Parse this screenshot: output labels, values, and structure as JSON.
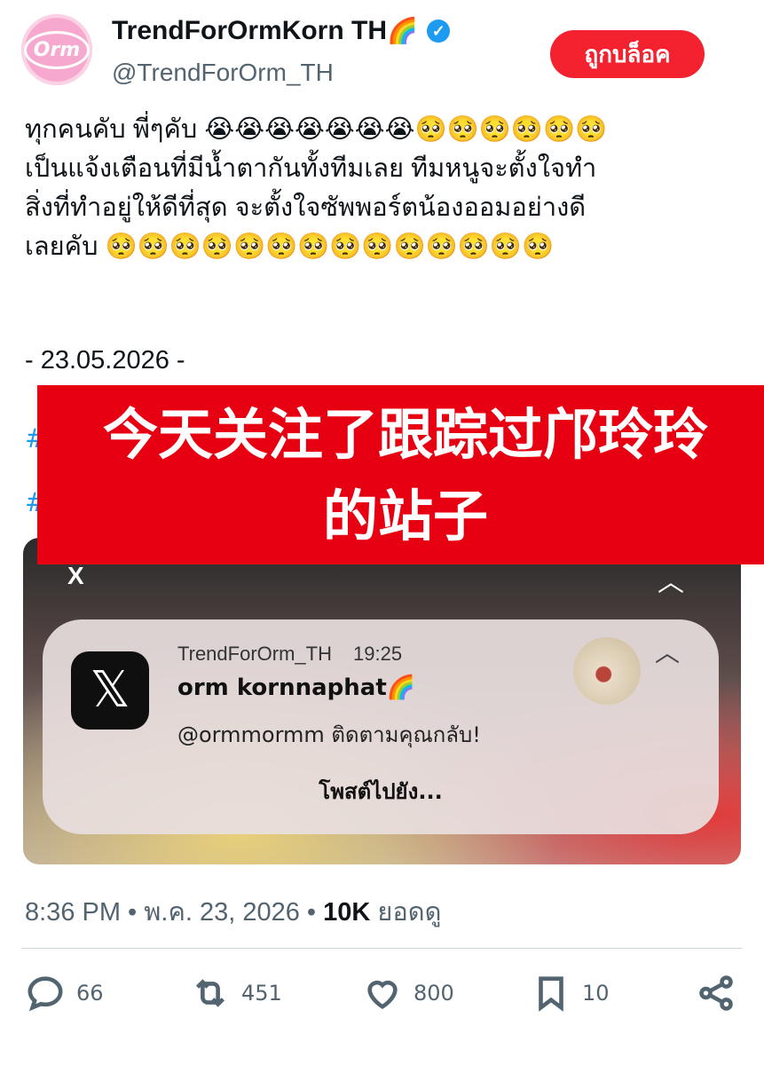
{
  "profile": {
    "avatar_text": "Orm",
    "display_name": "TrendForOrmKorn TH",
    "display_name_emoji": "🌈",
    "handle": "@TrendForOrm_TH",
    "block_button_label": "ถูกบล็อค"
  },
  "tweet": {
    "text": "ทุกคนคับ พี่ๆคับ 😭😭😭😭😭😭😭🥺🥺🥺🥺🥺🥺\nเป็นแจ้งเตือนที่มีน้ำตากันทั้งทีมเลย ทีมหนูจะตั้งใจทำ\nสิ่งที่ทำอยู่ให้ดีที่สุด จะตั้งใจซัพพอร์ตน้องออมอย่างดี\nเลยคับ 🥺🥺🥺🥺🥺🥺🥺🥺🥺🥺🥺🥺🥺🥺",
    "date_line": "- 23.05.2026 -",
    "hashtag_1": "#",
    "hashtag_2": "#"
  },
  "overlay": {
    "line1": "今天关注了跟踪过邝玲玲",
    "line2": "的站子"
  },
  "media": {
    "close_label": "X",
    "collapse_label": "︿",
    "notification": {
      "app_logo": "𝕏",
      "source": "TrendForOrm_TH",
      "time": "19:25",
      "title": "orm kornnaphat🌈",
      "body": "@ormmormm ติดตามคุณกลับ!",
      "action": "โพสต์ไปยัง...",
      "chevron": "︿"
    }
  },
  "meta": {
    "time": "8:36 PM",
    "separator": " • ",
    "date": "พ.ค. 23, 2026",
    "views_count": "10K",
    "views_label": " ยอดดู"
  },
  "actions": {
    "replies": "66",
    "reposts": "451",
    "likes": "800",
    "bookmarks": "10"
  }
}
